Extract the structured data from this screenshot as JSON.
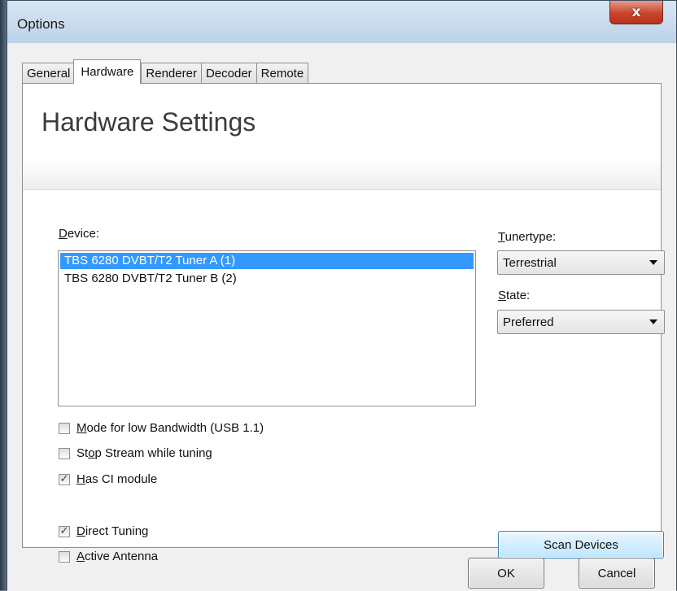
{
  "window": {
    "title": "Options",
    "close_label": "x"
  },
  "tabs": [
    {
      "label": "General",
      "active": false
    },
    {
      "label": "Hardware",
      "active": true
    },
    {
      "label": "Renderer",
      "active": false
    },
    {
      "label": "Decoder",
      "active": false
    },
    {
      "label": "Remote",
      "active": false
    }
  ],
  "page": {
    "title": "Hardware Settings"
  },
  "device": {
    "label_mnemonic": "D",
    "label_rest": "evice:",
    "items": [
      {
        "text": "TBS 6280 DVBT/T2 Tuner A (1)",
        "selected": true
      },
      {
        "text": "TBS 6280 DVBT/T2 Tuner B (2)",
        "selected": false
      }
    ]
  },
  "tunertype": {
    "label_mnemonic": "T",
    "label_rest": "unertype:",
    "value": "Terrestrial"
  },
  "state": {
    "label_mnemonic": "S",
    "label_rest": "tate:",
    "value": "Preferred"
  },
  "checks": {
    "low_bandwidth": {
      "pre": "",
      "mnemonic": "M",
      "post": "ode for low Bandwidth (USB 1.1)",
      "checked": false
    },
    "stop_stream": {
      "pre": "St",
      "mnemonic": "o",
      "post": "p Stream while tuning",
      "checked": false
    },
    "ci_module": {
      "pre": "",
      "mnemonic": "H",
      "post": "as CI module",
      "checked": true
    },
    "direct_tuning": {
      "pre": "",
      "mnemonic": "D",
      "post": "irect Tuning",
      "checked": true
    },
    "active_antenna": {
      "pre": "",
      "mnemonic": "A",
      "post": "ctive Antenna",
      "checked": false
    }
  },
  "buttons": {
    "scan": "Scan Devices",
    "ok": "OK",
    "cancel": "Cancel"
  },
  "colors": {
    "selection": "#3399ff",
    "scan_button": "#bee6fd",
    "close_button": "#c9442d"
  }
}
